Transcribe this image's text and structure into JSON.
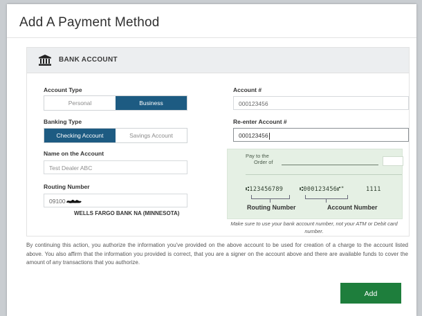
{
  "dialog": {
    "title": "Add A Payment Method"
  },
  "card": {
    "title": "BANK ACCOUNT",
    "icon": "bank-icon"
  },
  "account_type": {
    "label": "Account Type",
    "options": [
      "Personal",
      "Business"
    ],
    "selected": "Business"
  },
  "banking_type": {
    "label": "Banking Type",
    "options": [
      "Checking Account",
      "Savings Account"
    ],
    "selected": "Checking Account"
  },
  "name_on_account": {
    "label": "Name on the Account",
    "placeholder": "Test Dealer ABC"
  },
  "routing_number": {
    "label": "Routing Number",
    "value": "09100",
    "bank_name": "WELLS FARGO BANK NA (MINNESOTA)"
  },
  "account_number": {
    "label": "Account #",
    "value": "000123456"
  },
  "reenter_account": {
    "label": "Re-enter Account #",
    "value": "000123456"
  },
  "check_image": {
    "pay_to": "Pay to the",
    "order_of": "Order of",
    "routing_micr": "⑆123456789",
    "account_micr": "⑆000123456⑈\"",
    "check_micr": "1111",
    "routing_caption": "Routing Number",
    "account_caption": "Account Number"
  },
  "help_text": "Make sure to use your bank account number, not your ATM or Debit card number.",
  "disclaimer": "By continuing this action, you authorize the information you've provided on the above account to be used for creation of a charge to the account listed above. You also affirm that the information you provided is correct, that you are a signer on the account above and there are available funds to cover the amount of any transactions that you authorize.",
  "buttons": {
    "add": "Add"
  },
  "colors": {
    "accent": "#1d5b82",
    "primary_button": "#1e7e3c",
    "header_bg": "#eceef0",
    "check_bg": "#e5f0e4"
  }
}
